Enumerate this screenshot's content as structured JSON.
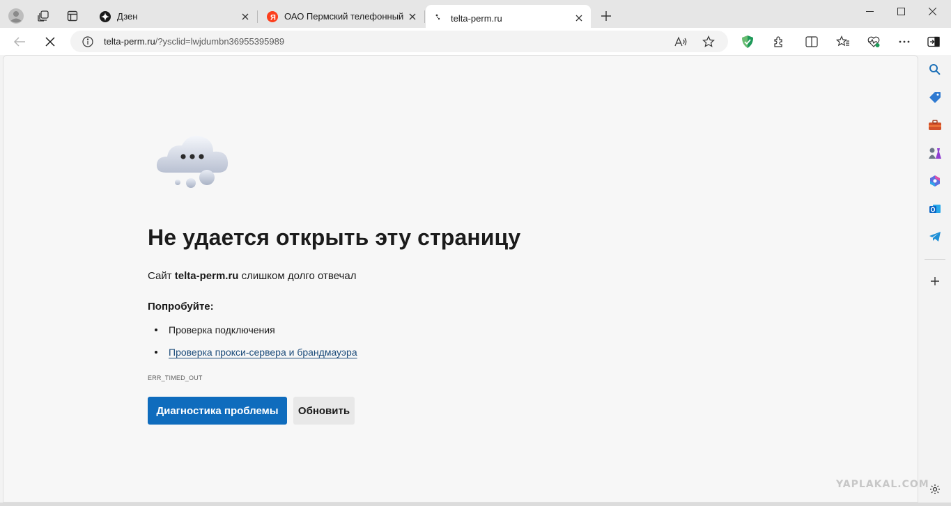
{
  "tabs": [
    {
      "title": "Дзен",
      "active": false
    },
    {
      "title": "ОАО Пермский телефонный за",
      "active": false
    },
    {
      "title": "telta-perm.ru",
      "active": true
    }
  ],
  "address": {
    "host": "telta-perm.ru",
    "path": "/?ysclid=lwjdumbn36955395989"
  },
  "error": {
    "heading": "Не удается открыть эту страницу",
    "message_prefix": "Сайт ",
    "message_host": "telta-perm.ru",
    "message_suffix": " слишком долго отвечал",
    "try_label": "Попробуйте:",
    "suggestions": [
      "Проверка подключения",
      "Проверка прокси-сервера и брандмауэра"
    ],
    "code": "ERR_TIMED_OUT",
    "diagnose_button": "Диагностика проблемы",
    "reload_button": "Обновить"
  },
  "watermark": "YAPLAKAL.COM",
  "colors": {
    "primary_button": "#0f6cbd",
    "link": "#1b4b7a",
    "tabstrip": "#e6e6e6"
  },
  "icons": {
    "sidebar": [
      "search-icon",
      "shopping-tag-icon",
      "tools-icon",
      "games-icon",
      "microsoft365-icon",
      "outlook-icon",
      "telegram-icon",
      "add-icon",
      "settings-icon"
    ]
  }
}
